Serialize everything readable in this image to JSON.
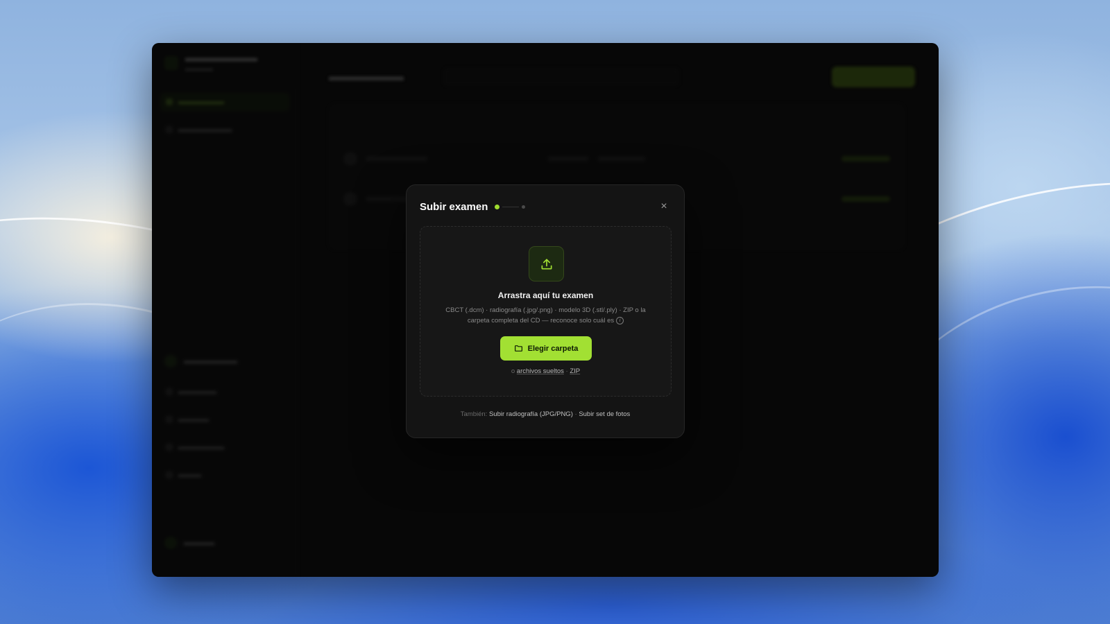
{
  "modal": {
    "title": "Subir examen",
    "close_label": "×",
    "dropzone": {
      "title": "Arrastra aquí tu examen",
      "description": "CBCT (.dcm) · radiografía (.jpg/.png) · modelo 3D (.stl/.ply) · ZIP o la carpeta completa del CD — reconoce solo cuál es",
      "info_glyph": "i",
      "choose_button": "Elegir carpeta",
      "alt_prefix": "o",
      "alt_files": "archivos sueltos",
      "alt_separator": "·",
      "alt_zip": "ZIP"
    },
    "footer": {
      "prefix": "También:",
      "link_radiography": "Subir radiografía (JPG/PNG)",
      "separator": "·",
      "link_photos": "Subir set de fotos"
    }
  },
  "icons": {
    "upload": "upload-icon",
    "folder": "folder-icon",
    "close": "close-icon",
    "info": "info-icon"
  },
  "colors": {
    "accent": "#a2e033",
    "modal_bg": "#141414",
    "window_bg": "#0b0b0b"
  }
}
